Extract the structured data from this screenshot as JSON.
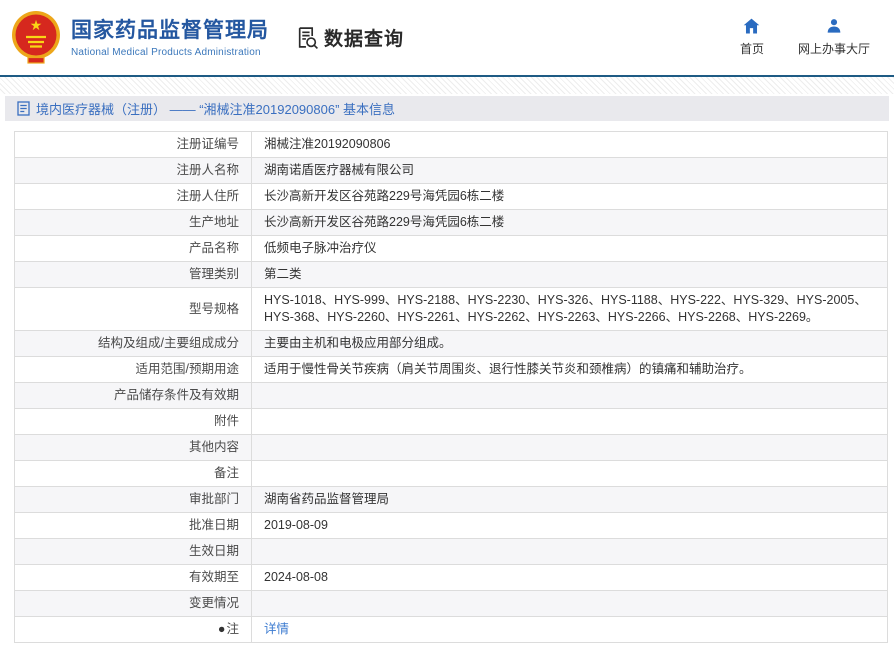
{
  "header": {
    "brand": {
      "title": "国家药品监督管理局",
      "subtitle": "National Medical Products Administration",
      "emblem": "china-national-emblem"
    },
    "data_query": {
      "label": "数据查询",
      "icon": "document-search-icon"
    },
    "nav": [
      {
        "label": "首页",
        "icon": "home-icon"
      },
      {
        "label": "网上办事大厅",
        "icon": "user-icon"
      }
    ]
  },
  "breadcrumb": {
    "icon": "document-icon",
    "text": "境内医疗器械（注册） —— “湘械注准20192090806” 基本信息"
  },
  "table": {
    "rows": [
      {
        "label": "注册证编号",
        "value": "湘械注准20192090806"
      },
      {
        "label": "注册人名称",
        "value": "湖南诺盾医疗器械有限公司"
      },
      {
        "label": "注册人住所",
        "value": "长沙高新开发区谷苑路229号海凭园6栋二楼"
      },
      {
        "label": "生产地址",
        "value": "长沙高新开发区谷苑路229号海凭园6栋二楼"
      },
      {
        "label": "产品名称",
        "value": "低频电子脉冲治疗仪"
      },
      {
        "label": "管理类别",
        "value": "第二类"
      },
      {
        "label": "型号规格",
        "value": "HYS-1018、HYS-999、HYS-2188、HYS-2230、HYS-326、HYS-1188、HYS-222、HYS-329、HYS-2005、HYS-368、HYS-2260、HYS-2261、HYS-2262、HYS-2263、HYS-2266、HYS-2268、HYS-2269。"
      },
      {
        "label": "结构及组成/主要组成成分",
        "value": "主要由主机和电极应用部分组成。"
      },
      {
        "label": "适用范围/预期用途",
        "value": "适用于慢性骨关节疾病（肩关节周围炎、退行性膝关节炎和颈椎病）的镇痛和辅助治疗。"
      },
      {
        "label": "产品储存条件及有效期",
        "value": ""
      },
      {
        "label": "附件",
        "value": ""
      },
      {
        "label": "其他内容",
        "value": ""
      },
      {
        "label": "备注",
        "value": ""
      },
      {
        "label": "审批部门",
        "value": "湖南省药品监督管理局"
      },
      {
        "label": "批准日期",
        "value": "2019-08-09"
      },
      {
        "label": "生效日期",
        "value": ""
      },
      {
        "label": "有效期至",
        "value": "2024-08-08"
      },
      {
        "label": "变更情况",
        "value": ""
      },
      {
        "label": "注",
        "label_icon": "●",
        "value": "详情",
        "link": true
      }
    ]
  },
  "colors": {
    "brand_blue": "#2457a0",
    "link_blue": "#3c7bd0",
    "divider_navy": "#1e5b84",
    "breadcrumb_bg": "#e9e9ed",
    "breadcrumb_text": "#3a6fc0",
    "row_alt_bg": "#f6f6f8",
    "table_border": "#dcdcdc",
    "nav_icon_blue": "#2a6bc0",
    "emblem_red": "#d6281e",
    "emblem_gold": "#eda61a"
  }
}
